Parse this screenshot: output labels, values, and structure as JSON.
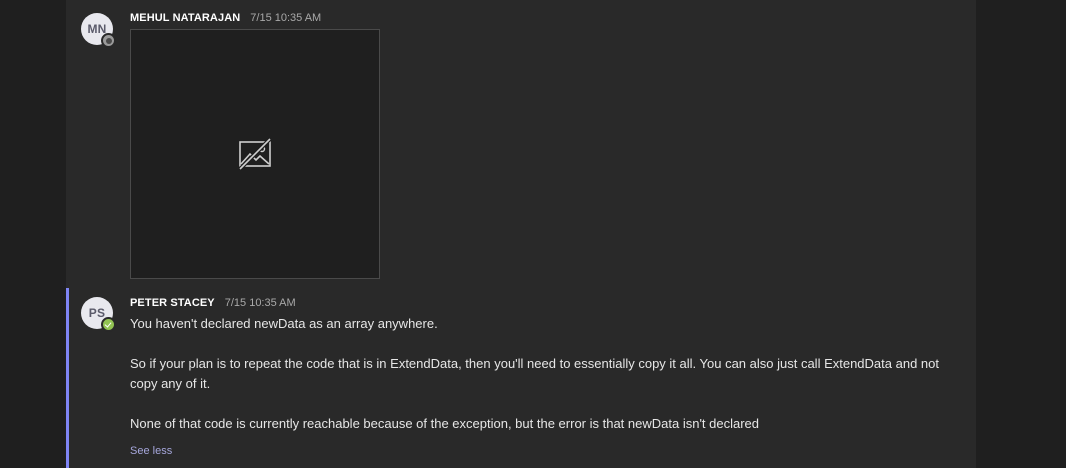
{
  "messages": [
    {
      "avatar_initials": "MN",
      "author": "MEHUL NATARAJAN",
      "timestamp": "7/15 10:35 AM",
      "presence": "away",
      "attachment": "broken-image-icon"
    },
    {
      "avatar_initials": "PS",
      "author": "PETER STACEY",
      "timestamp": "7/15 10:35 AM",
      "presence": "available",
      "paragraphs": [
        "You haven't declared newData as an array anywhere.",
        "So if your plan is to repeat the code that is in ExtendData, then you'll need to essentially copy it all. You can also just call ExtendData and not copy any of it.",
        "None of that code is currently reachable because of the exception, but the error is that newData isn't declared"
      ],
      "see_less_label": "See less"
    }
  ],
  "colors": {
    "accent": "#7f85f5",
    "link": "#a6a7dc",
    "available": "#92c353",
    "panel": "#292929",
    "background": "#1f1f1f"
  }
}
